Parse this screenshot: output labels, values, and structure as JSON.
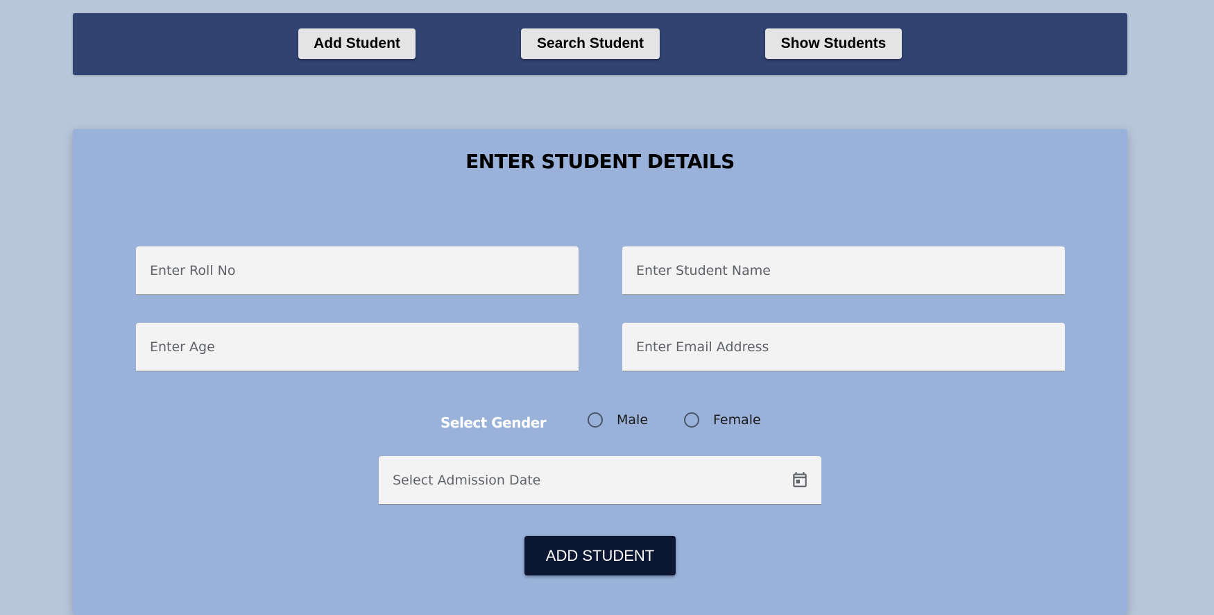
{
  "nav": {
    "add_student": "Add Student",
    "search_student": "Search Student",
    "show_students": "Show Students"
  },
  "form": {
    "title": "ENTER STUDENT DETAILS",
    "roll_no_placeholder": "Enter Roll No",
    "student_name_placeholder": "Enter Student Name",
    "age_placeholder": "Enter Age",
    "email_placeholder": "Enter Email Address",
    "gender_label": "Select Gender",
    "gender_options": [
      "Male",
      "Female"
    ],
    "admission_date_placeholder": "Select Admission Date",
    "submit_label": "ADD STUDENT",
    "calendar_icon": "calendar-icon"
  },
  "colors": {
    "page_background": "#b9c6da",
    "nav_bar": "#314372",
    "card_background": "#9ab2d9",
    "submit_button": "#0b1733"
  }
}
